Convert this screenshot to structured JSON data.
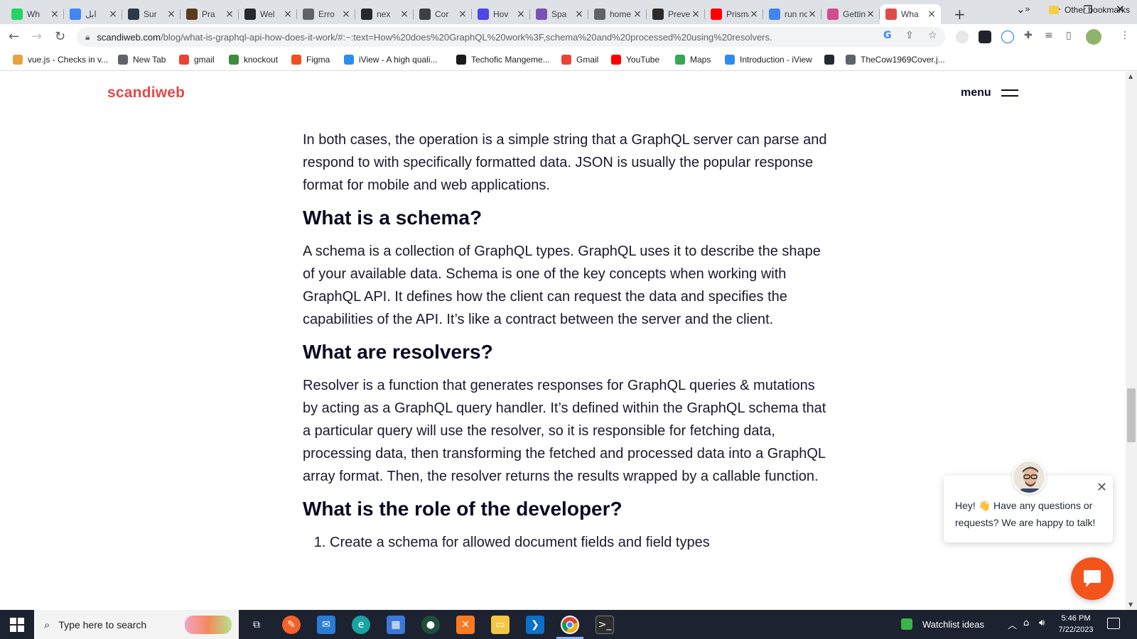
{
  "browser": {
    "tabs": [
      {
        "label": "Wh",
        "icon": "whatsapp-icon",
        "color": "#25d366"
      },
      {
        "label": "ابل",
        "icon": "google-drive-icon",
        "color": "#4285f4"
      },
      {
        "label": "Sur",
        "icon": "globe-icon",
        "color": "#2b3a4a"
      },
      {
        "label": "Pra",
        "icon": "cc-icon",
        "color": "#5a3b1c"
      },
      {
        "label": "Wel",
        "icon": "github-icon",
        "color": "#24292f"
      },
      {
        "label": "Erro",
        "icon": "globe-icon",
        "color": "#5f6368"
      },
      {
        "label": "nex",
        "icon": "github-icon",
        "color": "#24292f"
      },
      {
        "label": "Cor",
        "icon": "triangle-icon",
        "color": "#3c4043"
      },
      {
        "label": "Hov",
        "icon": "u-icon",
        "color": "#4f46e5"
      },
      {
        "label": "Spa",
        "icon": "bootstrap-icon",
        "color": "#7952b3"
      },
      {
        "label": "home p",
        "icon": "globe-icon",
        "color": "#5f6368"
      },
      {
        "label": "Prevent",
        "icon": "td-icon",
        "color": "#2b2b2b"
      },
      {
        "label": "Prisma",
        "icon": "youtube-icon",
        "color": "#ff0000"
      },
      {
        "label": "run noc",
        "icon": "google-icon",
        "color": "#4285f4"
      },
      {
        "label": "Getting",
        "icon": "gear-icon",
        "color": "#d14b8f"
      },
      {
        "label": "Wha",
        "icon": "scandiweb-icon",
        "color": "#e24a4a",
        "active": true
      }
    ],
    "new_tab": "+",
    "window_controls": {
      "tab_search": "⌄",
      "minimize": "—",
      "restore": "❐",
      "close": "✕"
    },
    "url_host": "scandiweb.com",
    "url_path": "/blog/what-is-graphql-api-how-does-it-work/#:~:text=How%20does%20GraphQL%20work%3F,schema%20and%20processed%20using%20resolvers.",
    "bookmarks": [
      {
        "label": "vue.js - Checks in v...",
        "icon": "vue-icon",
        "color": "#e8a33d"
      },
      {
        "label": "New Tab",
        "icon": "globe-icon",
        "color": "#5f6368"
      },
      {
        "label": "gmail",
        "icon": "gmail-icon",
        "color": "#ea4335"
      },
      {
        "label": "knockout",
        "icon": "vue-icon",
        "color": "#3c8d3c"
      },
      {
        "label": "Figma",
        "icon": "figma-icon",
        "color": "#f24e1e"
      },
      {
        "label": "iView - A high quali...",
        "icon": "iview-icon",
        "color": "#2d8cf0"
      },
      {
        "label": "Techofic Mangeme...",
        "icon": "techofic-icon",
        "color": "#1a1a1a"
      },
      {
        "label": "Gmail",
        "icon": "gmail-icon",
        "color": "#ea4335"
      },
      {
        "label": "YouTube",
        "icon": "youtube-icon",
        "color": "#ff0000"
      },
      {
        "label": "Maps",
        "icon": "maps-icon",
        "color": "#34a853"
      },
      {
        "label": "Introduction - iView",
        "icon": "iview-icon",
        "color": "#2d8cf0"
      },
      {
        "label": "",
        "icon": "github-icon",
        "color": "#24292f"
      },
      {
        "label": "TheCow1969Cover.j...",
        "icon": "globe-icon",
        "color": "#5f6368"
      }
    ],
    "bookmarks_more": "»",
    "other_bookmarks": "Other bookmarks"
  },
  "site": {
    "logo": "scandiweb",
    "menu_label": "menu",
    "brand_color": "#e24a4a"
  },
  "article": {
    "p1": "In both cases, the operation is a simple string that a GraphQL server can parse and respond to with specifically formatted data. JSON is usually the popular response format for mobile and web applications.",
    "h_schema": "What is a schema?",
    "p_schema": "A schema is a collection of GraphQL types. GraphQL uses it to describe the shape of your available data. Schema is one of the key concepts when working with GraphQL API. It defines how the client can request the data and specifies the capabilities of the API. It’s like a contract between the server and the client.",
    "h_resolvers": "What are resolvers?",
    "p_resolvers": "Resolver is a function that generates responses for GraphQL queries & mutations by acting as a GraphQL query handler. It’s defined within the GraphQL schema that a particular query will use the resolver, so it is responsible for fetching data, processing data, then transforming the fetched and processed data into a GraphQL array format. Then, the resolver returns the results wrapped by a callable function.",
    "h_developer": "What is the role of the developer?",
    "list_item_1": "Create a schema for allowed document fields and field types"
  },
  "chat": {
    "message": "Hey! 👋 Have any questions or requests? We are happy to talk!",
    "close": "✕",
    "launcher_color": "#f2541b"
  },
  "taskbar": {
    "search_placeholder": "Type here to search",
    "watchlist": "Watchlist ideas",
    "time": "5:46 PM",
    "date": "7/22/2023"
  }
}
